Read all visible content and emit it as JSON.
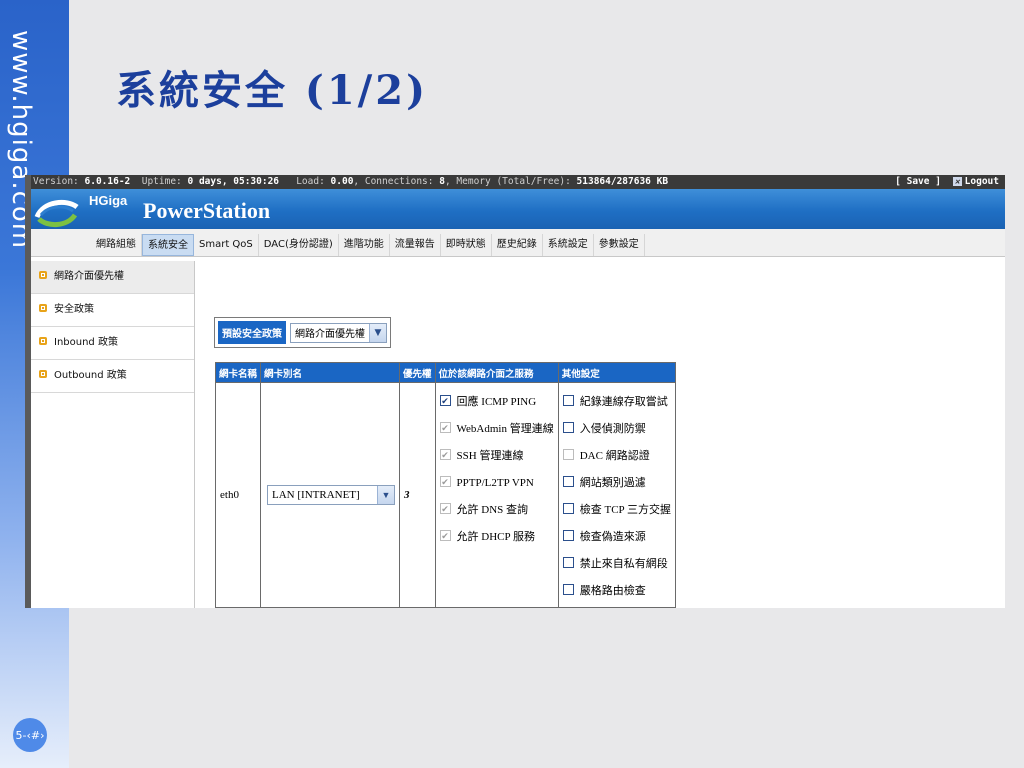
{
  "slide": {
    "url": "www.hgiga.com",
    "title": "系統安全 (1/2)",
    "page": "5-‹#›"
  },
  "status": {
    "version_label": "Version:",
    "version": "6.0.16-2",
    "uptime_label": "Uptime:",
    "uptime": "0 days, 05:30:26",
    "load_label": "Load:",
    "load": "0.00",
    "connections_label": ", Connections:",
    "connections": "8",
    "memory_label": ", Memory (Total/Free):",
    "memory": "513864/287636 KB",
    "save": "[ Save ]",
    "logout": "Logout"
  },
  "brand": {
    "small": "HGiga",
    "big": "PowerStation"
  },
  "nav": {
    "tabs": [
      "網路組態",
      "系統安全",
      "Smart QoS",
      "DAC(身份認證)",
      "進階功能",
      "流量報告",
      "即時狀態",
      "歷史紀錄",
      "系統設定",
      "參數設定"
    ],
    "active": "系統安全"
  },
  "sidebar": {
    "items": [
      "網路介面優先權",
      "安全政策",
      "Inbound 政策",
      "Outbound 政策"
    ]
  },
  "policy": {
    "label": "預設安全政策",
    "selected": "網路介面優先權"
  },
  "table": {
    "headers": [
      "網卡名稱",
      "網卡別名",
      "優先權",
      "位於該網路介面之服務",
      "其他設定"
    ],
    "row": {
      "name": "eth0",
      "alias": "LAN [INTRANET]",
      "priority": "3",
      "services": [
        {
          "label": "回應 ICMP PING",
          "checked": true,
          "disabled": false
        },
        {
          "label": "WebAdmin 管理連線",
          "checked": true,
          "disabled": true
        },
        {
          "label": "SSH 管理連線",
          "checked": true,
          "disabled": true
        },
        {
          "label": "PPTP/L2TP VPN",
          "checked": true,
          "disabled": true
        },
        {
          "label": "允許 DNS 查詢",
          "checked": true,
          "disabled": true
        },
        {
          "label": "允許 DHCP 服務",
          "checked": true,
          "disabled": true
        }
      ],
      "others": [
        {
          "label": "紀錄連線存取嘗試",
          "checked": false,
          "disabled": false
        },
        {
          "label": "入侵偵測防禦",
          "checked": false,
          "disabled": false
        },
        {
          "label": "DAC 網路認證",
          "checked": false,
          "disabled": true
        },
        {
          "label": "網站類別過濾",
          "checked": false,
          "disabled": false
        },
        {
          "label": "檢查 TCP 三方交握",
          "checked": false,
          "disabled": false
        },
        {
          "label": "檢查偽造來源",
          "checked": false,
          "disabled": false
        },
        {
          "label": "禁止來自私有網段",
          "checked": false,
          "disabled": false
        },
        {
          "label": "嚴格路由檢查",
          "checked": false,
          "disabled": false
        }
      ]
    }
  },
  "colors": {
    "accent": "#1a66c4",
    "title": "#1c3f9c",
    "sidebar_dot": "#e8a319"
  }
}
